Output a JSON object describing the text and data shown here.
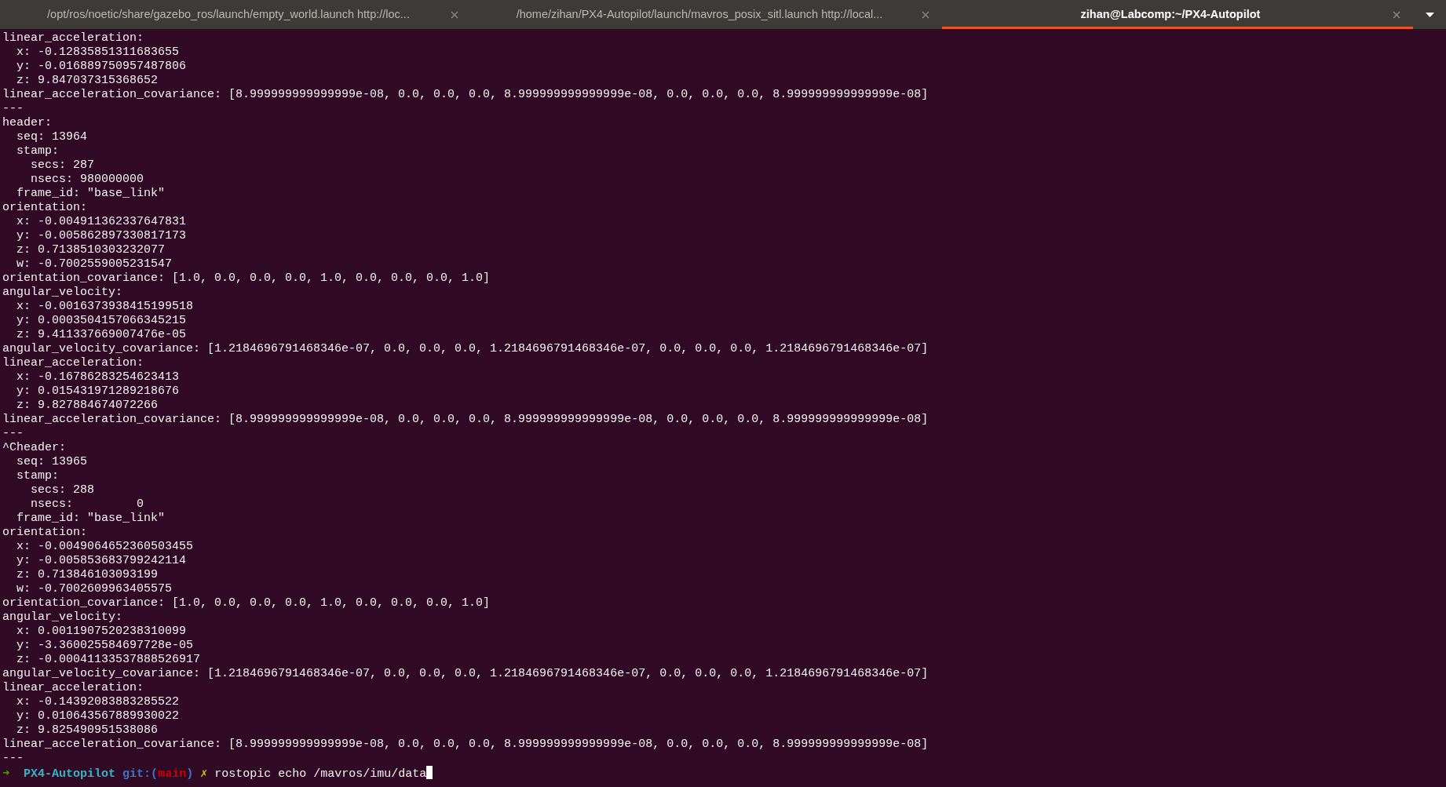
{
  "tabs": [
    {
      "title": "/opt/ros/noetic/share/gazebo_ros/launch/empty_world.launch http://loc...",
      "selected": false
    },
    {
      "title": "/home/zihan/PX4-Autopilot/launch/mavros_posix_sitl.launch http://local...",
      "selected": false
    },
    {
      "title": "zihan@Labcomp:~/PX4-Autopilot",
      "selected": true
    }
  ],
  "output_lines": [
    "linear_acceleration:",
    "  x: -0.12835851311683655",
    "  y: -0.016889750957487806",
    "  z: 9.847037315368652",
    "linear_acceleration_covariance: [8.999999999999999e-08, 0.0, 0.0, 0.0, 8.999999999999999e-08, 0.0, 0.0, 0.0, 8.999999999999999e-08]",
    "---",
    "header:",
    "  seq: 13964",
    "  stamp:",
    "    secs: 287",
    "    nsecs: 980000000",
    "  frame_id: \"base_link\"",
    "orientation:",
    "  x: -0.004911362337647831",
    "  y: -0.005862897330817173",
    "  z: 0.7138510303232077",
    "  w: -0.7002559005231547",
    "orientation_covariance: [1.0, 0.0, 0.0, 0.0, 1.0, 0.0, 0.0, 0.0, 1.0]",
    "angular_velocity:",
    "  x: -0.0016373938415199518",
    "  y: 0.0003504157066345215",
    "  z: 9.411337669007476e-05",
    "angular_velocity_covariance: [1.2184696791468346e-07, 0.0, 0.0, 0.0, 1.2184696791468346e-07, 0.0, 0.0, 0.0, 1.2184696791468346e-07]",
    "linear_acceleration:",
    "  x: -0.16786283254623413",
    "  y: 0.015431971289218676",
    "  z: 9.827884674072266",
    "linear_acceleration_covariance: [8.999999999999999e-08, 0.0, 0.0, 0.0, 8.999999999999999e-08, 0.0, 0.0, 0.0, 8.999999999999999e-08]",
    "---",
    "^Cheader:",
    "  seq: 13965",
    "  stamp:",
    "    secs: 288",
    "    nsecs:         0",
    "  frame_id: \"base_link\"",
    "orientation:",
    "  x: -0.0049064652360503455",
    "  y: -0.005853683799242114",
    "  z: 0.713846103093199",
    "  w: -0.7002609963405575",
    "orientation_covariance: [1.0, 0.0, 0.0, 0.0, 1.0, 0.0, 0.0, 0.0, 1.0]",
    "angular_velocity:",
    "  x: 0.0011907520238310099",
    "  y: -3.360025584697728e-05",
    "  z: -0.00041133537888526917",
    "angular_velocity_covariance: [1.2184696791468346e-07, 0.0, 0.0, 0.0, 1.2184696791468346e-07, 0.0, 0.0, 0.0, 1.2184696791468346e-07]",
    "linear_acceleration:",
    "  x: -0.14392083883285522",
    "  y: 0.010643567889930022",
    "  z: 9.825490951538086",
    "linear_acceleration_covariance: [8.999999999999999e-08, 0.0, 0.0, 0.0, 8.999999999999999e-08, 0.0, 0.0, 0.0, 8.999999999999999e-08]",
    "---"
  ],
  "prompt": {
    "arrow": "➜",
    "directory": "PX4-Autopilot",
    "git_open": "git:(",
    "branch": "main",
    "git_close": ")",
    "dirty_mark": "✗",
    "command": "rostopic echo /mavros/imu/data"
  }
}
